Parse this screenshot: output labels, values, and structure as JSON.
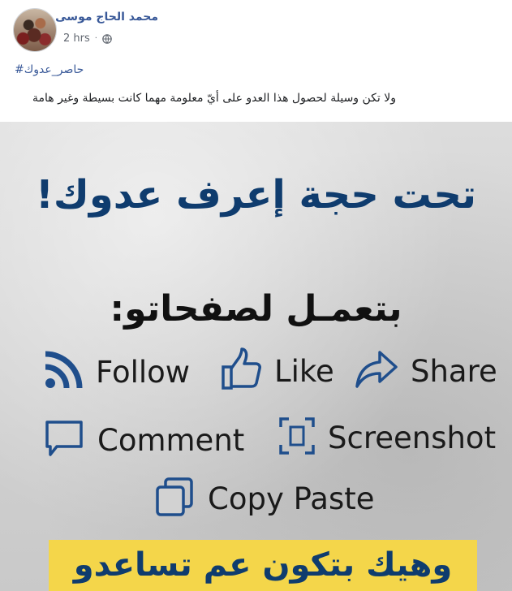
{
  "post": {
    "author_name": "محمد الحاج موسى",
    "timestamp": "2 hrs",
    "separator": "·",
    "privacy_icon": "globe-icon",
    "hashtag": "#حاصر_عدوك",
    "text": "ولا تكن وسيلة لحصول هذا العدو على أيّ معلومة مهما كانت بسيطة وغير هامة"
  },
  "poster": {
    "headline": "تحت حجة إعرف عدوك!",
    "subhead": "بتعمـل لصفحاتو:",
    "actions": [
      {
        "label": "Follow",
        "icon": "rss-icon"
      },
      {
        "label": "Like",
        "icon": "thumbs-up-icon"
      },
      {
        "label": "Share",
        "icon": "share-arrow-icon"
      },
      {
        "label": "Comment",
        "icon": "comment-bubble-icon"
      },
      {
        "label": "Screenshot",
        "icon": "screenshot-icon"
      },
      {
        "label": "Copy Paste",
        "icon": "copy-icon"
      }
    ],
    "banner_text": "وهيك بتكون عم تساعدو",
    "colors": {
      "headline": "#0f3c6e",
      "icons": "#1f4e8c",
      "banner": "#f4d64a"
    }
  }
}
